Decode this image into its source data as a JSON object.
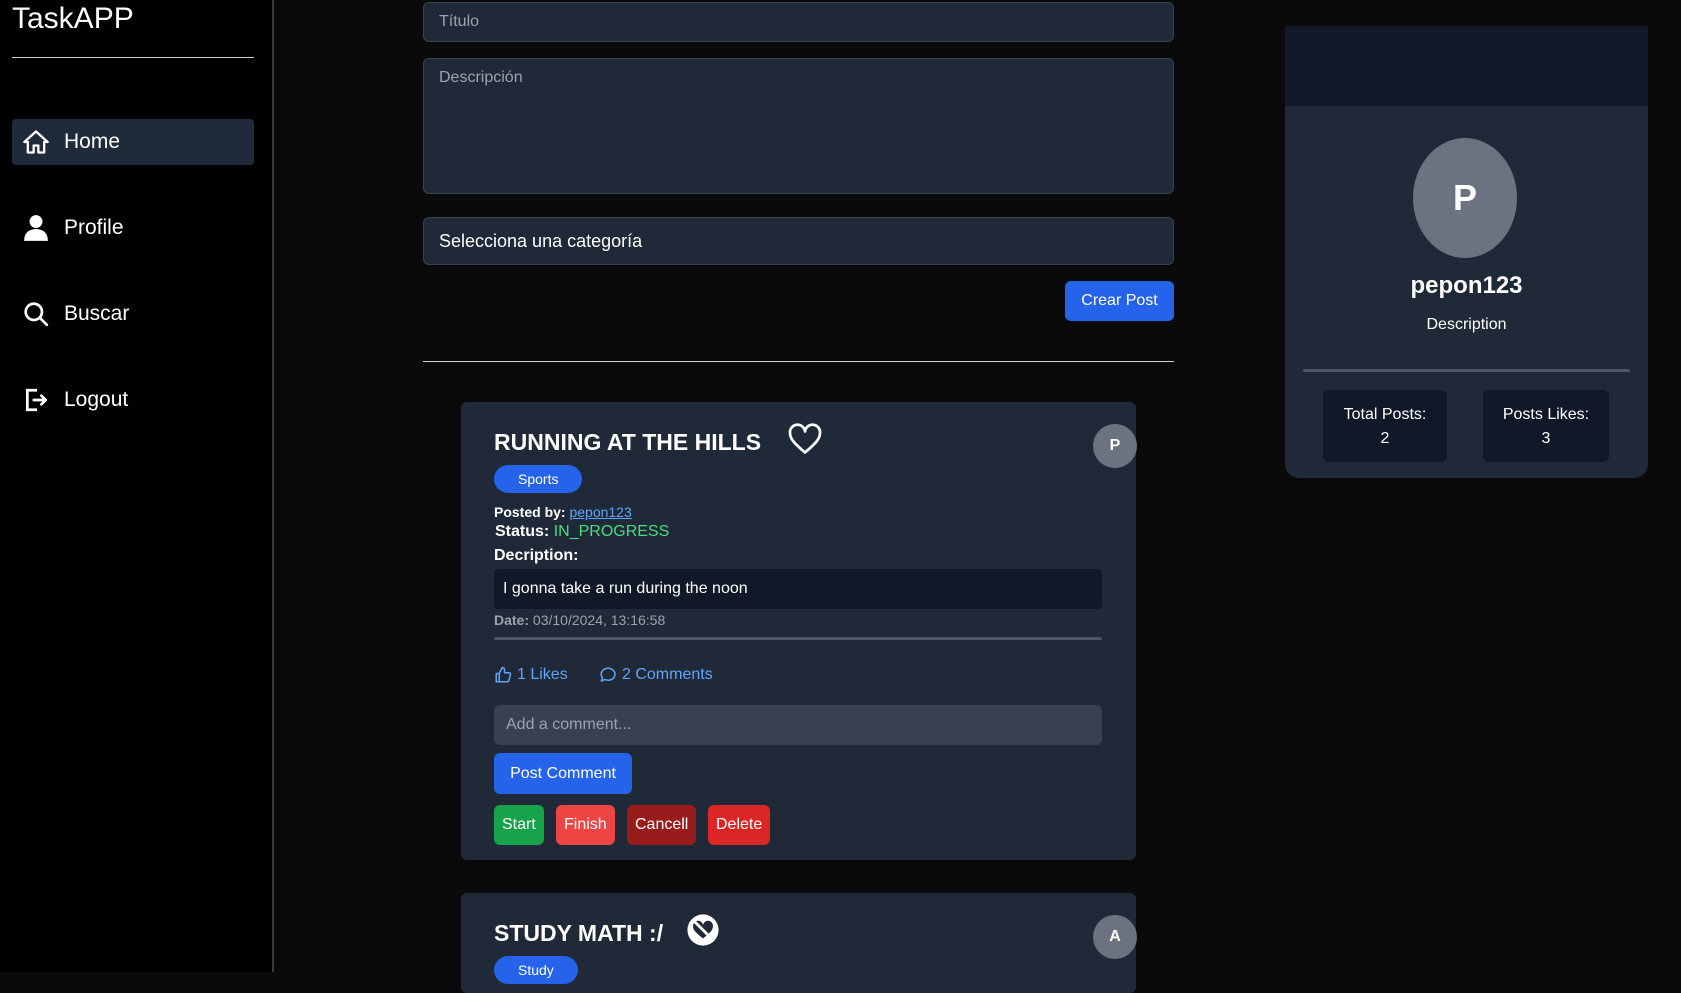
{
  "app": {
    "brand": "TaskAPP"
  },
  "sidebar": {
    "items": [
      {
        "label": "Home",
        "icon": "home-icon",
        "active": true
      },
      {
        "label": "Profile",
        "icon": "user-icon",
        "active": false
      },
      {
        "label": "Buscar",
        "icon": "search-icon",
        "active": false
      },
      {
        "label": "Logout",
        "icon": "logout-icon",
        "active": false
      }
    ]
  },
  "form": {
    "title_placeholder": "Título",
    "description_placeholder": "Descripción",
    "category_selected": "Selecciona una categoría",
    "submit_label": "Crear Post"
  },
  "posts": [
    {
      "title": "RUNNING AT THE HILLS",
      "liked": false,
      "author_initial": "P",
      "category": "Sports",
      "posted_by_label": "Posted by:",
      "author": "pepon123",
      "status_label": "Status:",
      "status": "IN_PROGRESS",
      "description_label": "Decription:",
      "description": "I gonna take a run during the noon",
      "date_label": "Date:",
      "date": "03/10/2024, 13:16:58",
      "likes_text": "1 Likes",
      "comments_text": "2 Comments",
      "comment_placeholder": "Add a comment...",
      "post_comment_label": "Post Comment",
      "actions": {
        "start": "Start",
        "finish": "Finish",
        "cancel": "Cancell",
        "delete": "Delete"
      }
    },
    {
      "title": "STUDY MATH :/",
      "liked": true,
      "author_initial": "A",
      "category": "Study"
    }
  ],
  "profile": {
    "initial": "P",
    "username": "pepon123",
    "description": "Description",
    "total_posts_label": "Total Posts:",
    "total_posts": "2",
    "posts_likes_label": "Posts Likes:",
    "posts_likes": "3"
  },
  "colors": {
    "accent": "#2563eb",
    "status_in_progress": "#4ade80",
    "link": "#60a5fa",
    "card_bg": "#1f2937",
    "start": "#16a34a",
    "finish": "#ef4444",
    "cancel": "#991b1b",
    "delete": "#dc2626"
  }
}
